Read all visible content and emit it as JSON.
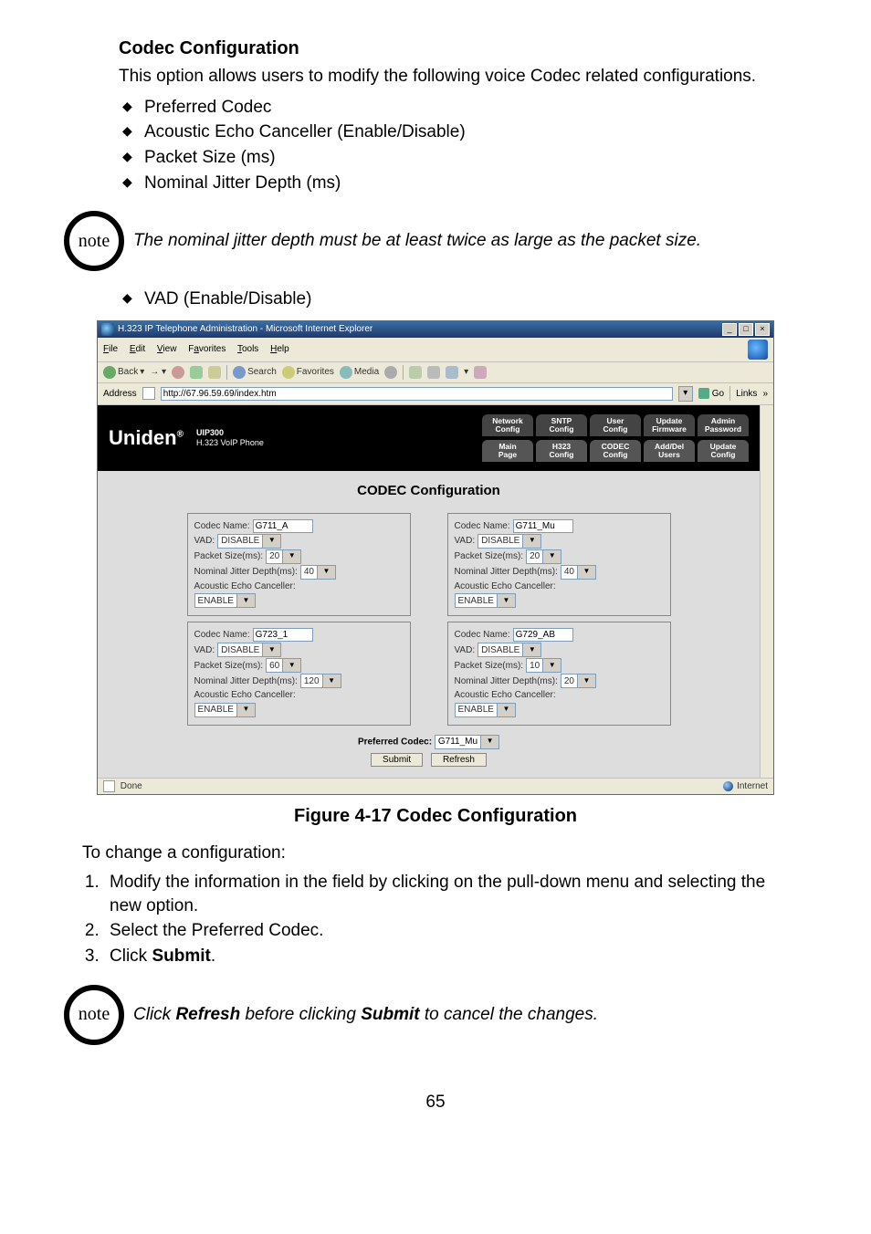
{
  "section_title": "Codec Configuration",
  "intro": "This option allows users to modify the following voice Codec related configurations.",
  "bullets1": [
    "Preferred Codec",
    "Acoustic Echo Canceller (Enable/Disable)",
    "Packet Size (ms)",
    "Nominal Jitter Depth (ms)"
  ],
  "note_label": "note",
  "note1": "The nominal jitter depth must be at least twice as large as the packet size.",
  "bullets2": [
    "VAD (Enable/Disable)"
  ],
  "figure_caption": "Figure 4-17 Codec Configuration",
  "change_intro": "To change a configuration:",
  "steps": [
    "Modify the information in the field by clicking on the pull-down menu and selecting the new option.",
    "Select the Preferred Codec."
  ],
  "step3_prefix": "Click ",
  "step3_bold": "Submit",
  "step3_suffix": ".",
  "note2_prefix": "Click ",
  "note2_b1": "Refresh",
  "note2_mid": " before clicking ",
  "note2_b2": "Submit",
  "note2_suffix": " to cancel the changes.",
  "page_number": "65",
  "ie": {
    "title": "H.323 IP Telephone Administration - Microsoft Internet Explorer",
    "menu": {
      "file": "File",
      "edit": "Edit",
      "view": "View",
      "favorites": "Favorites",
      "tools": "Tools",
      "help": "Help"
    },
    "toolbar": {
      "back": "Back",
      "search": "Search",
      "favorites": "Favorites",
      "media": "Media"
    },
    "address_label": "Address",
    "address_value": "http://67.96.59.69/index.htm",
    "go": "Go",
    "links": "Links",
    "brand": "Uniden",
    "brand_sub1": "UIP300",
    "brand_sub2": "H.323 VoIP Phone",
    "tabs_top": [
      "Network\nConfig",
      "SNTP\nConfig",
      "User\nConfig",
      "Update\nFirmware",
      "Admin\nPassword"
    ],
    "tabs_bottom": [
      "Main\nPage",
      "H323\nConfig",
      "CODEC\nConfig",
      "Add/Del\nUsers",
      "Update\nConfig"
    ],
    "codec_heading": "CODEC Configuration",
    "labels": {
      "codec_name": "Codec Name:",
      "vad": "VAD:",
      "packet": "Packet Size(ms):",
      "jitter": "Nominal Jitter Depth(ms):",
      "aec": "Acoustic Echo Canceller:"
    },
    "codec": [
      {
        "name": "G711_A",
        "vad": "DISABLE",
        "packet": "20",
        "jitter": "40",
        "aec": "ENABLE"
      },
      {
        "name": "G711_Mu",
        "vad": "DISABLE",
        "packet": "20",
        "jitter": "40",
        "aec": "ENABLE"
      },
      {
        "name": "G723_1",
        "vad": "DISABLE",
        "packet": "60",
        "jitter": "120",
        "aec": "ENABLE"
      },
      {
        "name": "G729_AB",
        "vad": "DISABLE",
        "packet": "10",
        "jitter": "20",
        "aec": "ENABLE"
      }
    ],
    "preferred_label": "Preferred Codec:",
    "preferred_value": "G711_Mu",
    "submit": "Submit",
    "refresh": "Refresh",
    "status_done": "Done",
    "status_zone": "Internet"
  }
}
